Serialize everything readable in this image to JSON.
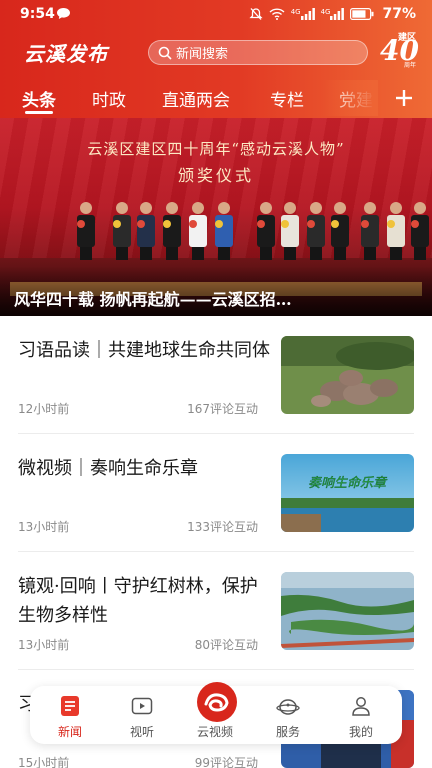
{
  "status_bar": {
    "time": "9:54",
    "network_1": "4G",
    "network_2": "4G",
    "battery": "77%"
  },
  "header": {
    "app_title": "云溪发布",
    "search_placeholder": "新闻搜索",
    "anniversary_top": "建区",
    "anniversary_number": "40",
    "anniversary_sub": "周年",
    "accent_color": "#d8271c"
  },
  "tabs": [
    {
      "label": "头条",
      "active": true
    },
    {
      "label": "时政",
      "active": false
    },
    {
      "label": "直通两会",
      "active": false
    },
    {
      "label": "专栏",
      "active": false
    },
    {
      "label": "党建",
      "active": false
    }
  ],
  "banner": {
    "heading": "云溪区建区四十周年“感动云溪人物”",
    "subheading": "颁奖仪式",
    "caption": "风华四十载 扬帆再起航——云溪区招…"
  },
  "news": [
    {
      "title": "习语品读｜共建地球生命共同体",
      "time": "12小时前",
      "comments": "167评论互动",
      "image": "elephants-photo"
    },
    {
      "title": "微视频｜奏响生命乐章",
      "time": "13小时前",
      "comments": "133评论互动",
      "image": "wetland-title-photo",
      "image_text": "奏响生命乐章"
    },
    {
      "title": "镜观·回响丨守护红树林，保护生物多样性",
      "time": "13小时前",
      "comments": "80评论互动",
      "image": "mangrove-aerial-photo"
    },
    {
      "title": "习",
      "time": "15小时前",
      "comments": "99评论互动",
      "image": "meeting-photo"
    }
  ],
  "bottom_nav": [
    {
      "label": "新闻",
      "icon": "news-icon",
      "active": true
    },
    {
      "label": "视听",
      "icon": "play-icon",
      "active": false
    },
    {
      "label": "云视频",
      "icon": "cloud-video-logo-icon",
      "active": false
    },
    {
      "label": "服务",
      "icon": "service-icon",
      "active": false
    },
    {
      "label": "我的",
      "icon": "profile-icon",
      "active": false
    }
  ]
}
